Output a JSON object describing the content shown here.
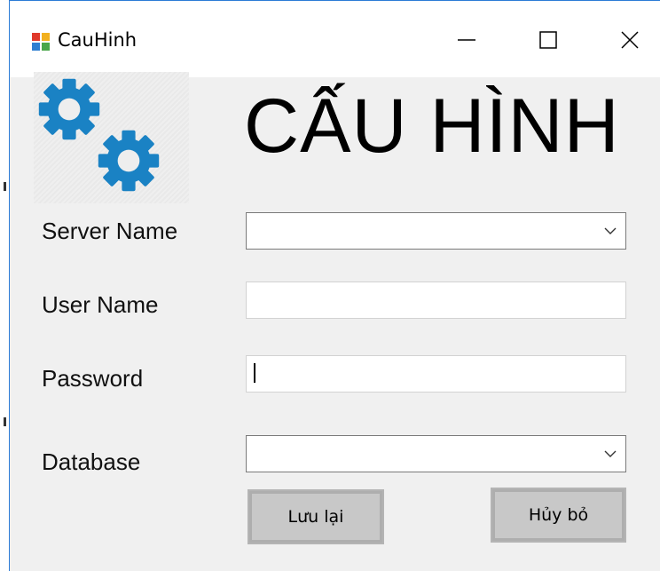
{
  "window": {
    "title": "CauHinh",
    "controls": {
      "minimize_icon": "minimize-icon",
      "maximize_icon": "maximize-icon",
      "close_icon": "close-icon"
    }
  },
  "header": {
    "logo_icon": "gears-icon",
    "title": "CẤU HÌNH",
    "logo_color": "#1a82c4"
  },
  "form": {
    "server_name": {
      "label": "Server Name",
      "value": ""
    },
    "user_name": {
      "label": "User Name",
      "value": ""
    },
    "password": {
      "label": "Password",
      "value": ""
    },
    "database": {
      "label": "Database",
      "value": ""
    }
  },
  "buttons": {
    "save_label": "Lưu lại",
    "cancel_label": "Hủy bỏ"
  }
}
